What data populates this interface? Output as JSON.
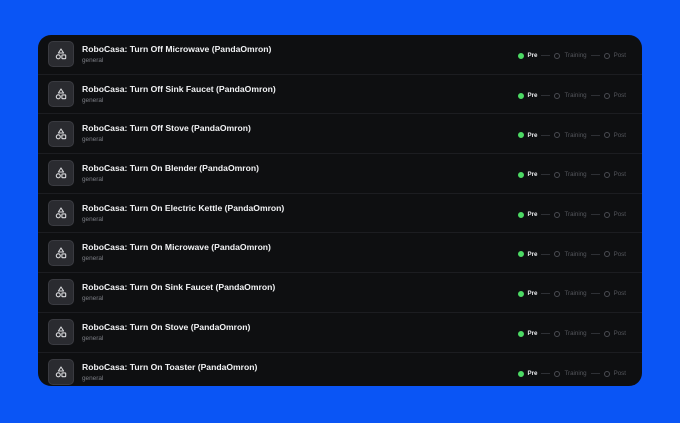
{
  "status_labels": {
    "pre": "Pre",
    "training": "Training",
    "post": "Post"
  },
  "colors": {
    "background": "#0a55f5",
    "panel": "#0e0f11",
    "active_dot": "#4cd964"
  },
  "tasks": [
    {
      "title": "RoboCasa: Turn Off Microwave (PandaOmron)",
      "category": "general",
      "icon": "shapes-icon",
      "stage": "pre"
    },
    {
      "title": "RoboCasa: Turn Off Sink Faucet (PandaOmron)",
      "category": "general",
      "icon": "shapes-icon",
      "stage": "pre"
    },
    {
      "title": "RoboCasa: Turn Off Stove (PandaOmron)",
      "category": "general",
      "icon": "shapes-icon",
      "stage": "pre"
    },
    {
      "title": "RoboCasa: Turn On Blender (PandaOmron)",
      "category": "general",
      "icon": "shapes-icon",
      "stage": "pre"
    },
    {
      "title": "RoboCasa: Turn On Electric Kettle (PandaOmron)",
      "category": "general",
      "icon": "shapes-icon",
      "stage": "pre"
    },
    {
      "title": "RoboCasa: Turn On Microwave (PandaOmron)",
      "category": "general",
      "icon": "shapes-icon",
      "stage": "pre"
    },
    {
      "title": "RoboCasa: Turn On Sink Faucet (PandaOmron)",
      "category": "general",
      "icon": "shapes-icon",
      "stage": "pre"
    },
    {
      "title": "RoboCasa: Turn On Stove (PandaOmron)",
      "category": "general",
      "icon": "shapes-icon",
      "stage": "pre"
    },
    {
      "title": "RoboCasa: Turn On Toaster (PandaOmron)",
      "category": "general",
      "icon": "shapes-icon",
      "stage": "pre"
    }
  ]
}
